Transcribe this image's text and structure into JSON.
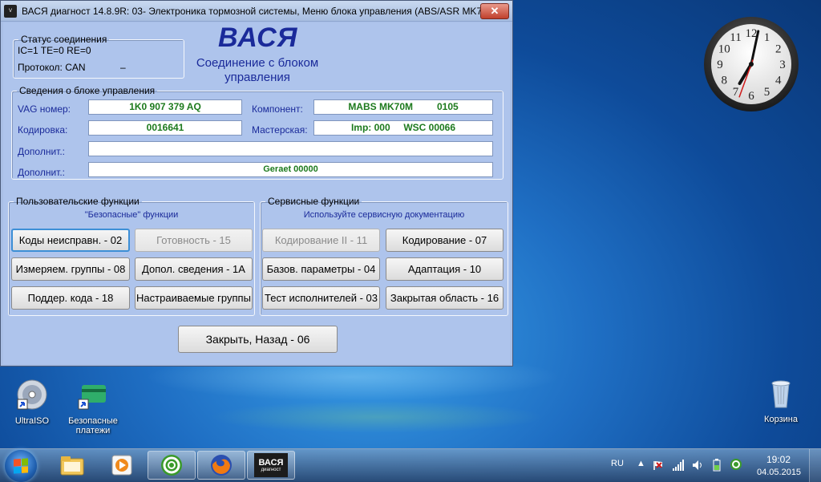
{
  "window": {
    "title": "ВАСЯ диагност 14.8.9R: 03- Электроника тормозной системы,  Меню блока управления (ABS/ASR MK70...",
    "close_label": "✕"
  },
  "connection_status": {
    "legend": "Статус соединения",
    "line1": "IC=1  TE=0   RE=0",
    "protocol_label": "Протокол: CAN",
    "protocol_extra": "–"
  },
  "header": {
    "logo": "ВАСЯ",
    "message": "Соединение с блоком управления"
  },
  "ecu_info": {
    "legend": "Сведения о блоке управления",
    "vag_label": "VAG номер:",
    "vag_value": "1K0 907 379 AQ",
    "component_label": "Компонент:",
    "component_value": "MABS MK70M         0105",
    "coding_label": "Кодировка:",
    "coding_value": "0016641",
    "workshop_label": "Мастерская:",
    "workshop_value": "Imp: 000     WSC 00066",
    "extra1_label": "Дополнит.:",
    "extra1_value": "",
    "extra2_label": "Дополнит.:",
    "extra2_value": "Geraet 00000"
  },
  "user_functions": {
    "legend": "Пользовательские функции",
    "caption": "\"Безопасные\" функции",
    "buttons": [
      {
        "label": "Коды неисправн. - 02"
      },
      {
        "label": "Готовность - 15"
      },
      {
        "label": "Измеряем. группы - 08"
      },
      {
        "label": "Допол. сведения - 1A"
      },
      {
        "label": "Поддер. кода - 18"
      },
      {
        "label": "Настраиваемые группы"
      }
    ]
  },
  "service_functions": {
    "legend": "Сервисные функции",
    "caption": "Используйте сервисную документацию",
    "buttons": [
      {
        "label": "Кодирование II - 11"
      },
      {
        "label": "Кодирование - 07"
      },
      {
        "label": "Базов. параметры - 04"
      },
      {
        "label": "Адаптация - 10"
      },
      {
        "label": "Тест исполнителей - 03"
      },
      {
        "label": "Закрытая область - 16"
      }
    ]
  },
  "close_back_label": "Закрыть, Назад - 06",
  "clock": {
    "numerals": [
      "12",
      "1",
      "2",
      "3",
      "4",
      "5",
      "6",
      "7",
      "8",
      "9",
      "10",
      "11"
    ]
  },
  "desktop_icons": [
    {
      "label": "UltraISO"
    },
    {
      "label": "Безопасные платежи"
    },
    {
      "label": "Корзина"
    }
  ],
  "taskbar": {
    "tray_lang": "RU",
    "time": "19:02",
    "date": "04.05.2015",
    "vasya_label": "ВАСЯ",
    "vasya_sub": "диагност"
  },
  "colors": {
    "accent": "#1a2a9a",
    "value_green": "#1d7a1d"
  },
  "icons": [
    "windows-start-icon",
    "explorer-icon",
    "media-player-icon",
    "mail-agent-icon",
    "firefox-icon",
    "vasya-icon",
    "flag-icon",
    "signal-icon",
    "volume-icon",
    "battery-icon"
  ]
}
